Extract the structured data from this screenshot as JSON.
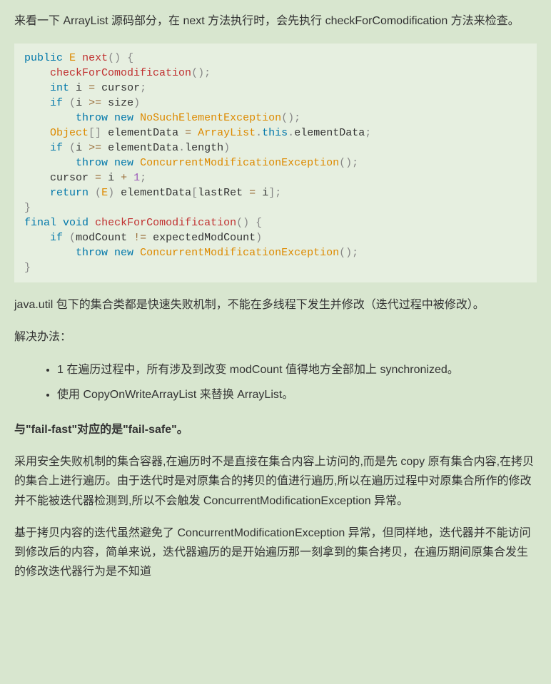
{
  "p1": "来看一下 ArrayList 源码部分，在 next 方法执行时，会先执行 checkForComodification 方法来检查。",
  "code": {
    "tokens": [
      [
        "kw",
        "public"
      ],
      [
        "sp",
        " "
      ],
      [
        "cls-name",
        "E"
      ],
      [
        "sp",
        " "
      ],
      [
        "fn-name",
        "next"
      ],
      [
        "paren",
        "()"
      ],
      [
        "sp",
        " "
      ],
      [
        "paren",
        "{"
      ],
      [
        "nl"
      ],
      [
        "sp",
        "    "
      ],
      [
        "fn-name",
        "checkForComodification"
      ],
      [
        "paren",
        "()"
      ],
      [
        "paren",
        ";"
      ],
      [
        "nl"
      ],
      [
        "sp",
        "    "
      ],
      [
        "kw",
        "int"
      ],
      [
        "sp",
        " "
      ],
      [
        "ident",
        "i "
      ],
      [
        "str-op",
        "="
      ],
      [
        "sp",
        " "
      ],
      [
        "ident",
        "cursor"
      ],
      [
        "paren",
        ";"
      ],
      [
        "nl"
      ],
      [
        "sp",
        "    "
      ],
      [
        "kw",
        "if"
      ],
      [
        "sp",
        " "
      ],
      [
        "paren",
        "("
      ],
      [
        "ident",
        "i "
      ],
      [
        "str-op",
        ">="
      ],
      [
        "sp",
        " "
      ],
      [
        "ident",
        "size"
      ],
      [
        "paren",
        ")"
      ],
      [
        "nl"
      ],
      [
        "sp",
        "        "
      ],
      [
        "kw",
        "throw"
      ],
      [
        "sp",
        " "
      ],
      [
        "kw",
        "new"
      ],
      [
        "sp",
        " "
      ],
      [
        "cls-name",
        "NoSuchElementException"
      ],
      [
        "paren",
        "()"
      ],
      [
        "paren",
        ";"
      ],
      [
        "nl"
      ],
      [
        "sp",
        "    "
      ],
      [
        "cls-name",
        "Object"
      ],
      [
        "paren",
        "[]"
      ],
      [
        "sp",
        " "
      ],
      [
        "ident",
        "elementData "
      ],
      [
        "str-op",
        "="
      ],
      [
        "sp",
        " "
      ],
      [
        "cls-name",
        "ArrayList"
      ],
      [
        "paren",
        "."
      ],
      [
        "kw",
        "this"
      ],
      [
        "paren",
        "."
      ],
      [
        "ident",
        "elementData"
      ],
      [
        "paren",
        ";"
      ],
      [
        "nl"
      ],
      [
        "sp",
        "    "
      ],
      [
        "kw",
        "if"
      ],
      [
        "sp",
        " "
      ],
      [
        "paren",
        "("
      ],
      [
        "ident",
        "i "
      ],
      [
        "str-op",
        ">="
      ],
      [
        "sp",
        " "
      ],
      [
        "ident",
        "elementData"
      ],
      [
        "paren",
        "."
      ],
      [
        "ident",
        "length"
      ],
      [
        "paren",
        ")"
      ],
      [
        "nl"
      ],
      [
        "sp",
        "        "
      ],
      [
        "kw",
        "throw"
      ],
      [
        "sp",
        " "
      ],
      [
        "kw",
        "new"
      ],
      [
        "sp",
        " "
      ],
      [
        "cls-name",
        "ConcurrentModificationException"
      ],
      [
        "paren",
        "()"
      ],
      [
        "paren",
        ";"
      ],
      [
        "nl"
      ],
      [
        "sp",
        "    "
      ],
      [
        "ident",
        "cursor "
      ],
      [
        "str-op",
        "="
      ],
      [
        "sp",
        " "
      ],
      [
        "ident",
        "i "
      ],
      [
        "str-op",
        "+"
      ],
      [
        "sp",
        " "
      ],
      [
        "num",
        "1"
      ],
      [
        "paren",
        ";"
      ],
      [
        "nl"
      ],
      [
        "sp",
        "    "
      ],
      [
        "kw",
        "return"
      ],
      [
        "sp",
        " "
      ],
      [
        "paren",
        "("
      ],
      [
        "cls-name",
        "E"
      ],
      [
        "paren",
        ")"
      ],
      [
        "sp",
        " "
      ],
      [
        "ident",
        "elementData"
      ],
      [
        "paren",
        "["
      ],
      [
        "ident",
        "lastRet "
      ],
      [
        "str-op",
        "="
      ],
      [
        "sp",
        " "
      ],
      [
        "ident",
        "i"
      ],
      [
        "paren",
        "]"
      ],
      [
        "paren",
        ";"
      ],
      [
        "nl"
      ],
      [
        "paren",
        "}"
      ],
      [
        "nl"
      ],
      [
        "kw",
        "final"
      ],
      [
        "sp",
        " "
      ],
      [
        "kw",
        "void"
      ],
      [
        "sp",
        " "
      ],
      [
        "fn-name",
        "checkForComodification"
      ],
      [
        "paren",
        "()"
      ],
      [
        "sp",
        " "
      ],
      [
        "paren",
        "{"
      ],
      [
        "nl"
      ],
      [
        "sp",
        "    "
      ],
      [
        "kw",
        "if"
      ],
      [
        "sp",
        " "
      ],
      [
        "paren",
        "("
      ],
      [
        "ident",
        "modCount "
      ],
      [
        "str-op",
        "!="
      ],
      [
        "sp",
        " "
      ],
      [
        "ident",
        "expectedModCount"
      ],
      [
        "paren",
        ")"
      ],
      [
        "nl"
      ],
      [
        "sp",
        "        "
      ],
      [
        "kw",
        "throw"
      ],
      [
        "sp",
        " "
      ],
      [
        "kw",
        "new"
      ],
      [
        "sp",
        " "
      ],
      [
        "cls-name",
        "ConcurrentModificationException"
      ],
      [
        "paren",
        "()"
      ],
      [
        "paren",
        ";"
      ],
      [
        "nl"
      ],
      [
        "paren",
        "}"
      ]
    ]
  },
  "p2": "java.util 包下的集合类都是快速失败机制，不能在多线程下发生并修改（迭代过程中被修改）。",
  "p3": "解决办法：",
  "list": [
    "1 在遍历过程中，所有涉及到改变 modCount 值得地方全部加上 synchronized。",
    "使用 CopyOnWriteArrayList 来替换 ArrayList。"
  ],
  "h1": "与\"fail-fast\"对应的是\"fail-safe\"。",
  "p4": "采用安全失败机制的集合容器,在遍历时不是直接在集合内容上访问的,而是先 copy 原有集合内容,在拷贝的集合上进行遍历。由于迭代时是对原集合的拷贝的值进行遍历,所以在遍历过程中对原集合所作的修改并不能被迭代器检测到,所以不会触发 ConcurrentModificationException 异常。",
  "p5": "基于拷贝内容的迭代虽然避免了 ConcurrentModificationException 异常，但同样地，迭代器并不能访问到修改后的内容，简单来说，迭代器遍历的是开始遍历那一刻拿到的集合拷贝，在遍历期间原集合发生的修改迭代器行为是不知道"
}
